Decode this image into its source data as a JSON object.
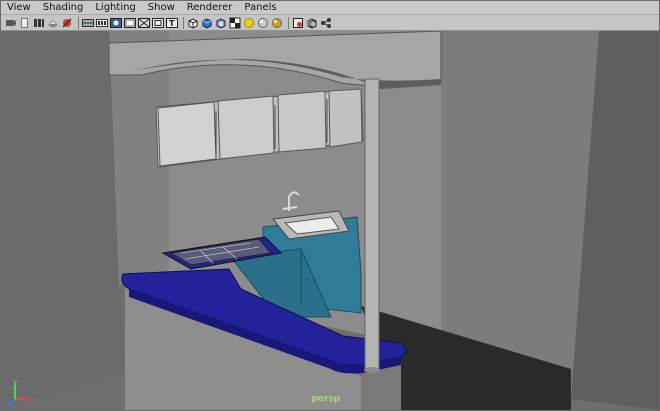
{
  "menu": {
    "items": [
      "View",
      "Shading",
      "Lighting",
      "Show",
      "Renderer",
      "Panels"
    ]
  },
  "toolbar": {
    "groups": [
      [
        "camera-attributes-icon",
        "bookmarks-icon",
        "image-plane-icon",
        "2d-pan-zoom-icon",
        "grease-pencil-icon"
      ],
      [
        "grid-icon",
        "film-gate-icon",
        "resolution-gate-icon",
        "gate-mask-icon",
        "field-chart-icon",
        "safe-action-icon",
        "safe-title-icon"
      ],
      [
        "wireframe-icon",
        "smooth-shade-icon",
        "default-material-icon",
        "shadows-icon",
        "use-all-lights-icon",
        "shaded-light-icon",
        "xray-icon"
      ],
      [
        "isolate-select-icon",
        "xray-joints-icon",
        "xray-active-icon"
      ]
    ],
    "colors": {
      "wireframe": "#ffffff",
      "shaded": "#2f6fd6",
      "light": "#f0d000",
      "sphere": "#c9c9c9",
      "isolate": "#d43a2a"
    }
  },
  "viewport": {
    "camera_label": "persp",
    "axis": {
      "x_label": "x",
      "y_label": "y",
      "z_label": "z",
      "x_color": "#ff4040",
      "y_color": "#40ff40",
      "z_color": "#4080ff"
    },
    "colors": {
      "background": "#6f6f6f",
      "wall": "#8a8a8a",
      "counter": "#23229a",
      "cabinet": "#2f7b98",
      "floor": "#2b2b2b",
      "pole": "#b4b4b4",
      "camera_label": "#a9d96a"
    }
  }
}
